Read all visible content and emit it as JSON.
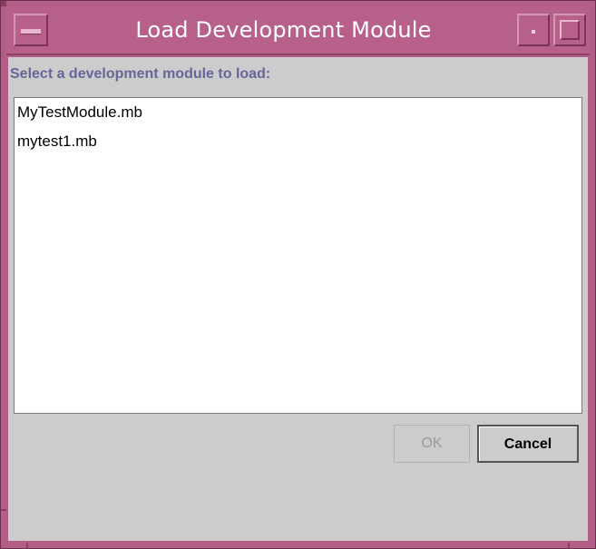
{
  "window": {
    "title": "Load Development Module"
  },
  "dialog": {
    "prompt": "Select a development module to load:",
    "modules": [
      "MyTestModule.mb",
      "mytest1.mb"
    ],
    "ok_label": "OK",
    "cancel_label": "Cancel",
    "ok_enabled": false
  },
  "colors": {
    "frame": "#b25e86",
    "client_bg": "#cccccc",
    "prompt_text": "#666699"
  },
  "icons": {
    "window_menu": "window-menu-icon",
    "minimize": "minimize-icon",
    "maximize": "maximize-icon"
  }
}
